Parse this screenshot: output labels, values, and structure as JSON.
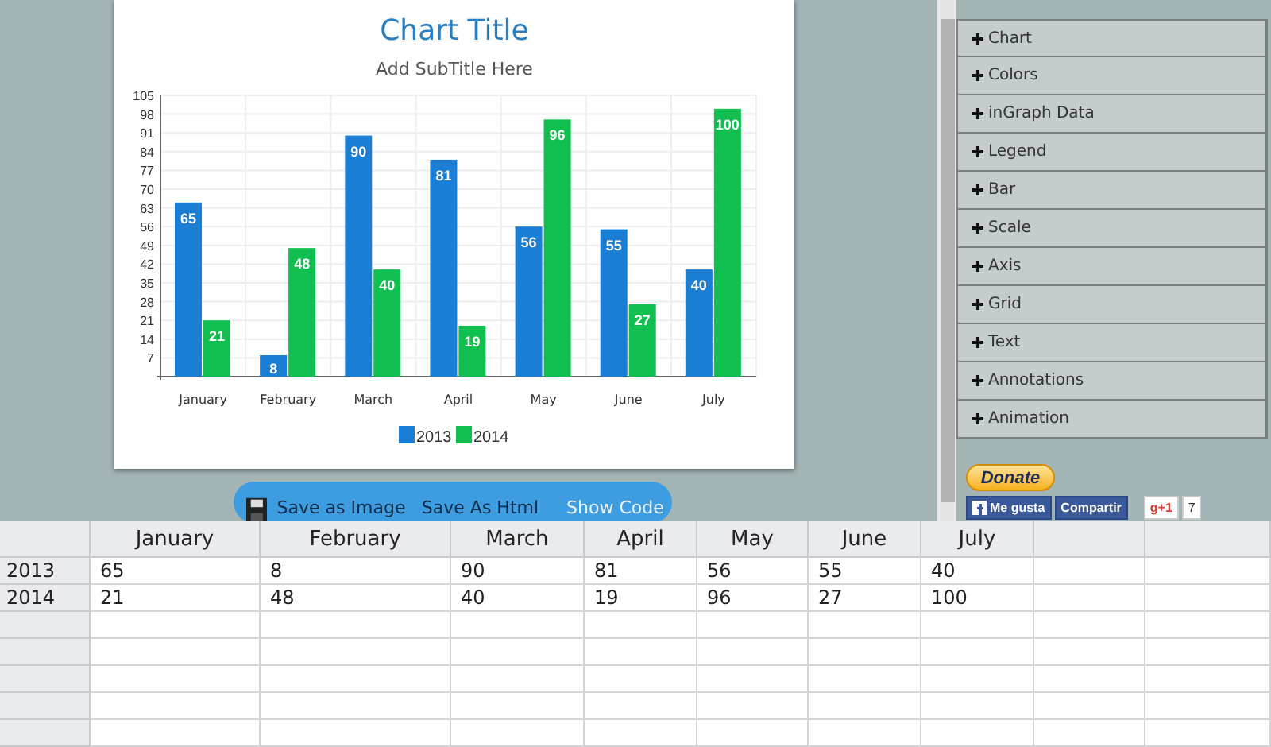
{
  "chart": {
    "subtitle": "Add SubTitle Here",
    "chart_data": {
      "type": "bar",
      "title": "Chart Title",
      "grid": true,
      "legend": "bottom",
      "categories": [
        "January",
        "February",
        "March",
        "April",
        "May",
        "June",
        "July"
      ],
      "series": [
        {
          "name": "2013",
          "color": "#1a7fd4",
          "values": [
            65,
            8,
            90,
            81,
            56,
            55,
            40
          ]
        },
        {
          "name": "2014",
          "color": "#10bf50",
          "values": [
            21,
            48,
            40,
            19,
            96,
            27,
            100
          ]
        }
      ],
      "ylim": [
        0,
        105
      ],
      "yticks": [
        7,
        14,
        21,
        28,
        35,
        42,
        49,
        56,
        63,
        70,
        77,
        84,
        91,
        98,
        105
      ],
      "data_labels": true
    }
  },
  "toolbar": {
    "buttons": [
      "Save as Image",
      "Save As Html",
      "Show Code"
    ]
  },
  "settings": {
    "sections": [
      {
        "label": "Chart",
        "expanded": false
      },
      {
        "label": "Colors",
        "expanded": false
      },
      {
        "label": "inGraph Data",
        "expanded": false
      },
      {
        "label": "Legend",
        "expanded": false
      },
      {
        "label": "Bar",
        "expanded": false
      },
      {
        "label": "Scale",
        "expanded": false
      },
      {
        "label": "Axis",
        "expanded": false
      },
      {
        "label": "Grid",
        "expanded": false
      },
      {
        "label": "Text",
        "expanded": false
      },
      {
        "label": "Annotations",
        "expanded": false
      },
      {
        "label": "Animation",
        "expanded": false
      }
    ]
  },
  "donate": {
    "label": "Donate"
  },
  "social": {
    "like": "Me gusta",
    "share": "Compartir",
    "plus": "g+1",
    "count": "7"
  },
  "table": {
    "columns": [
      "January",
      "February",
      "March",
      "April",
      "May",
      "June",
      "July"
    ],
    "rows": [
      {
        "label": "2013",
        "cells": [
          "65",
          "8",
          "90",
          "81",
          "56",
          "55",
          "40"
        ]
      },
      {
        "label": "2014",
        "cells": [
          "21",
          "48",
          "40",
          "19",
          "96",
          "27",
          "100"
        ]
      }
    ]
  }
}
